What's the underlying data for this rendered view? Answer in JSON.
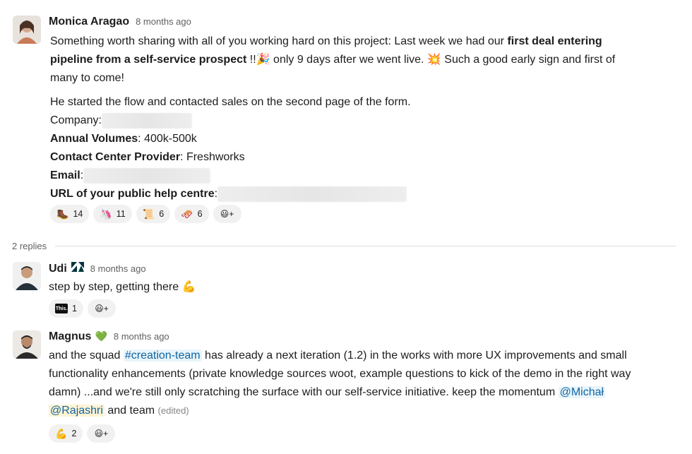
{
  "messages": {
    "monica": {
      "author": "Monica Aragao",
      "time": "8 months ago",
      "p1_a": "Something worth sharing with all of you working hard on this project: Last week we had our ",
      "p1_bold_a": "first deal entering",
      "p1_bold_b": "pipeline from a self-service prospect",
      "p1_b": " !!",
      "p1_c": " only 9 days after we went live. ",
      "p1_d": " Such a good early sign and first of",
      "p1_e": "many to come!",
      "emoji_party": "🎉",
      "emoji_boom": "💥",
      "p2": "He started the flow and contacted sales on the second page of the form.",
      "company_label": "Company:",
      "volumes_label": "Annual Volumes",
      "volumes_value": ": 400k-500k",
      "provider_label": "Contact Center Provider",
      "provider_value": ": Freshworks",
      "email_label": "Email",
      "email_colon": ":",
      "url_label": "URL of your public help centre",
      "url_colon": ":",
      "reactions": [
        {
          "emoji": "🥾",
          "count": "14"
        },
        {
          "emoji": "🦄",
          "count": "11"
        },
        {
          "emoji": "📜",
          "count": "6"
        },
        {
          "emoji": "🛷",
          "count": "6"
        }
      ]
    },
    "replies_label": "2 replies",
    "udi": {
      "author": "Udi",
      "status_icon": "Z",
      "time": "8 months ago",
      "text": "step by step, getting there ",
      "emoji": "💪",
      "reactions": [
        {
          "emoji": "This.",
          "count": "1"
        }
      ]
    },
    "magnus": {
      "author": "Magnus",
      "time": "8 months ago",
      "l1_a": "and the squad ",
      "channel": "#creation-team",
      "l1_b": " has already a next iteration (1.2) in the works with more UX improvements and small",
      "l2": "functionality enhancements (private knowledge sources woot, example questions to kick of the demo in the right way",
      "l3": "damn) ...and we're still only scratching the surface with our self-service initiative. keep the momentum ",
      "mention1": "@Michał",
      "mention2": "@Rajashri",
      "l4": " and team ",
      "edited": "(edited)",
      "reactions": [
        {
          "emoji": "💪",
          "count": "2"
        }
      ]
    }
  },
  "icons": {
    "add_reaction": "😃+",
    "heart_status": "💚"
  },
  "colors": {
    "link": "#1264a3",
    "mention_bg": "#e8f5fa",
    "self_mention_bg": "#fdf3d3",
    "pill_bg": "#f1f1f1",
    "muted": "#616061"
  }
}
